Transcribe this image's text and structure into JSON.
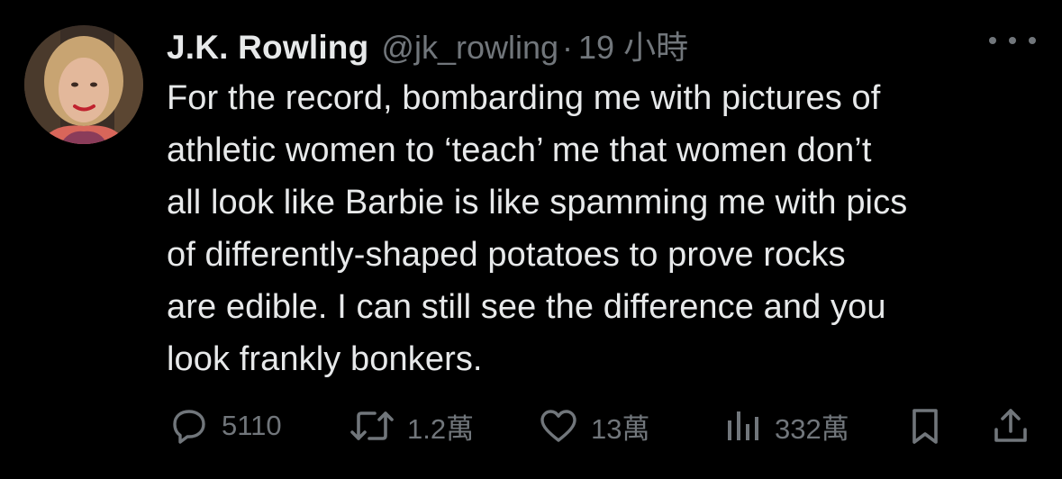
{
  "author": {
    "display_name": "J.K. Rowling",
    "handle": "@jk_rowling",
    "separator": "·",
    "time": "19 小時"
  },
  "tweet_lines": [
    "For the record, bombarding me with pictures of",
    "athletic women to ‘teach’ me that women don’t",
    "all look like Barbie is like spamming me with pics",
    "of differently-shaped potatoes to prove rocks",
    "are edible. I can still see the difference and you",
    "look frankly bonkers."
  ],
  "actions": {
    "replies": "5110",
    "reposts": "1.2萬",
    "likes": "13萬",
    "views": "332萬"
  },
  "icons": {
    "more": "more-dots-icon",
    "reply": "reply-bubble-icon",
    "repost": "repost-arrows-icon",
    "like": "heart-icon",
    "views": "bar-chart-icon",
    "bookmark": "bookmark-icon",
    "share": "share-upload-icon"
  },
  "colors": {
    "background": "#000000",
    "primary_text": "#e7e9ea",
    "secondary_text": "#71767b"
  }
}
